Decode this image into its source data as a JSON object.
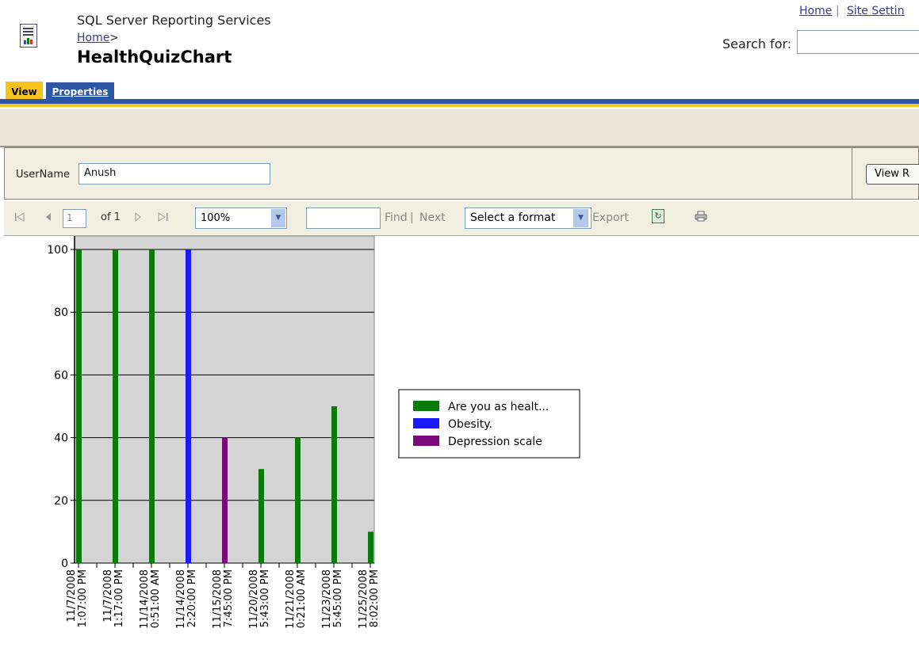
{
  "header": {
    "app_title": "SQL Server Reporting Services",
    "breadcrumb_home": "Home",
    "breadcrumb_sep": ">",
    "page_title": "HealthQuizChart"
  },
  "top_links": {
    "home": "Home",
    "separator": "|",
    "site_settings": "Site Settin"
  },
  "search": {
    "label": "Search for:",
    "value": ""
  },
  "tabs": [
    {
      "label": "View"
    },
    {
      "label": "Properties"
    }
  ],
  "parameters": {
    "username_label": "UserName",
    "username_value": "Anush",
    "view_report_label": "View R"
  },
  "toolbar": {
    "first_page_icon": "first-page-icon",
    "prev_page_icon": "prev-page-icon",
    "page_value": "1",
    "page_of": "of 1",
    "next_page_icon": "next-page-icon",
    "last_page_icon": "last-page-icon",
    "zoom": "100%",
    "find_value": "",
    "find_label": "Find",
    "find_sep": "|",
    "next_label": "Next",
    "format_selected": "Select a format",
    "export_label": "Export",
    "refresh_icon": "refresh-icon",
    "print_icon": "print-icon"
  },
  "colors": {
    "accent_gold": "#f5c41c",
    "accent_blue": "#2b57a6",
    "series_green": "#0a7a0a",
    "series_blue": "#1a1aff",
    "series_purple": "#7a0a7a",
    "plot_bg": "#d4d4d4"
  },
  "chart_data": {
    "type": "bar",
    "title": "",
    "xlabel": "",
    "ylabel": "",
    "ylim": [
      0,
      100
    ],
    "yticks": [
      0,
      20,
      40,
      60,
      80,
      100
    ],
    "grid": true,
    "legend_position": "right",
    "categories": [
      [
        "11/7/2008",
        "1:07:00 PM"
      ],
      [
        "11/7/2008",
        "1:17:00 PM"
      ],
      [
        "11/14/2008",
        "0:51:00 AM"
      ],
      [
        "11/14/2008",
        "2:20:00 PM"
      ],
      [
        "11/15/2008",
        "7:45:00 PM"
      ],
      [
        "11/20/2008",
        "5:43:00 PM"
      ],
      [
        "11/21/2008",
        "0:21:00 AM"
      ],
      [
        "11/23/2008",
        "5:45:00 PM"
      ],
      [
        "11/25/2008",
        "8:02:00 PM"
      ]
    ],
    "series": [
      {
        "name": "Are you as healt...",
        "color": "#0a7a0a",
        "values": [
          100,
          100,
          100,
          null,
          null,
          30,
          40,
          50,
          10
        ]
      },
      {
        "name": "Obesity.",
        "color": "#1a1aff",
        "values": [
          null,
          null,
          null,
          100,
          null,
          null,
          null,
          null,
          null
        ]
      },
      {
        "name": "Depression scale",
        "color": "#7a0a7a",
        "values": [
          null,
          null,
          null,
          null,
          40,
          null,
          null,
          null,
          null
        ]
      }
    ]
  }
}
